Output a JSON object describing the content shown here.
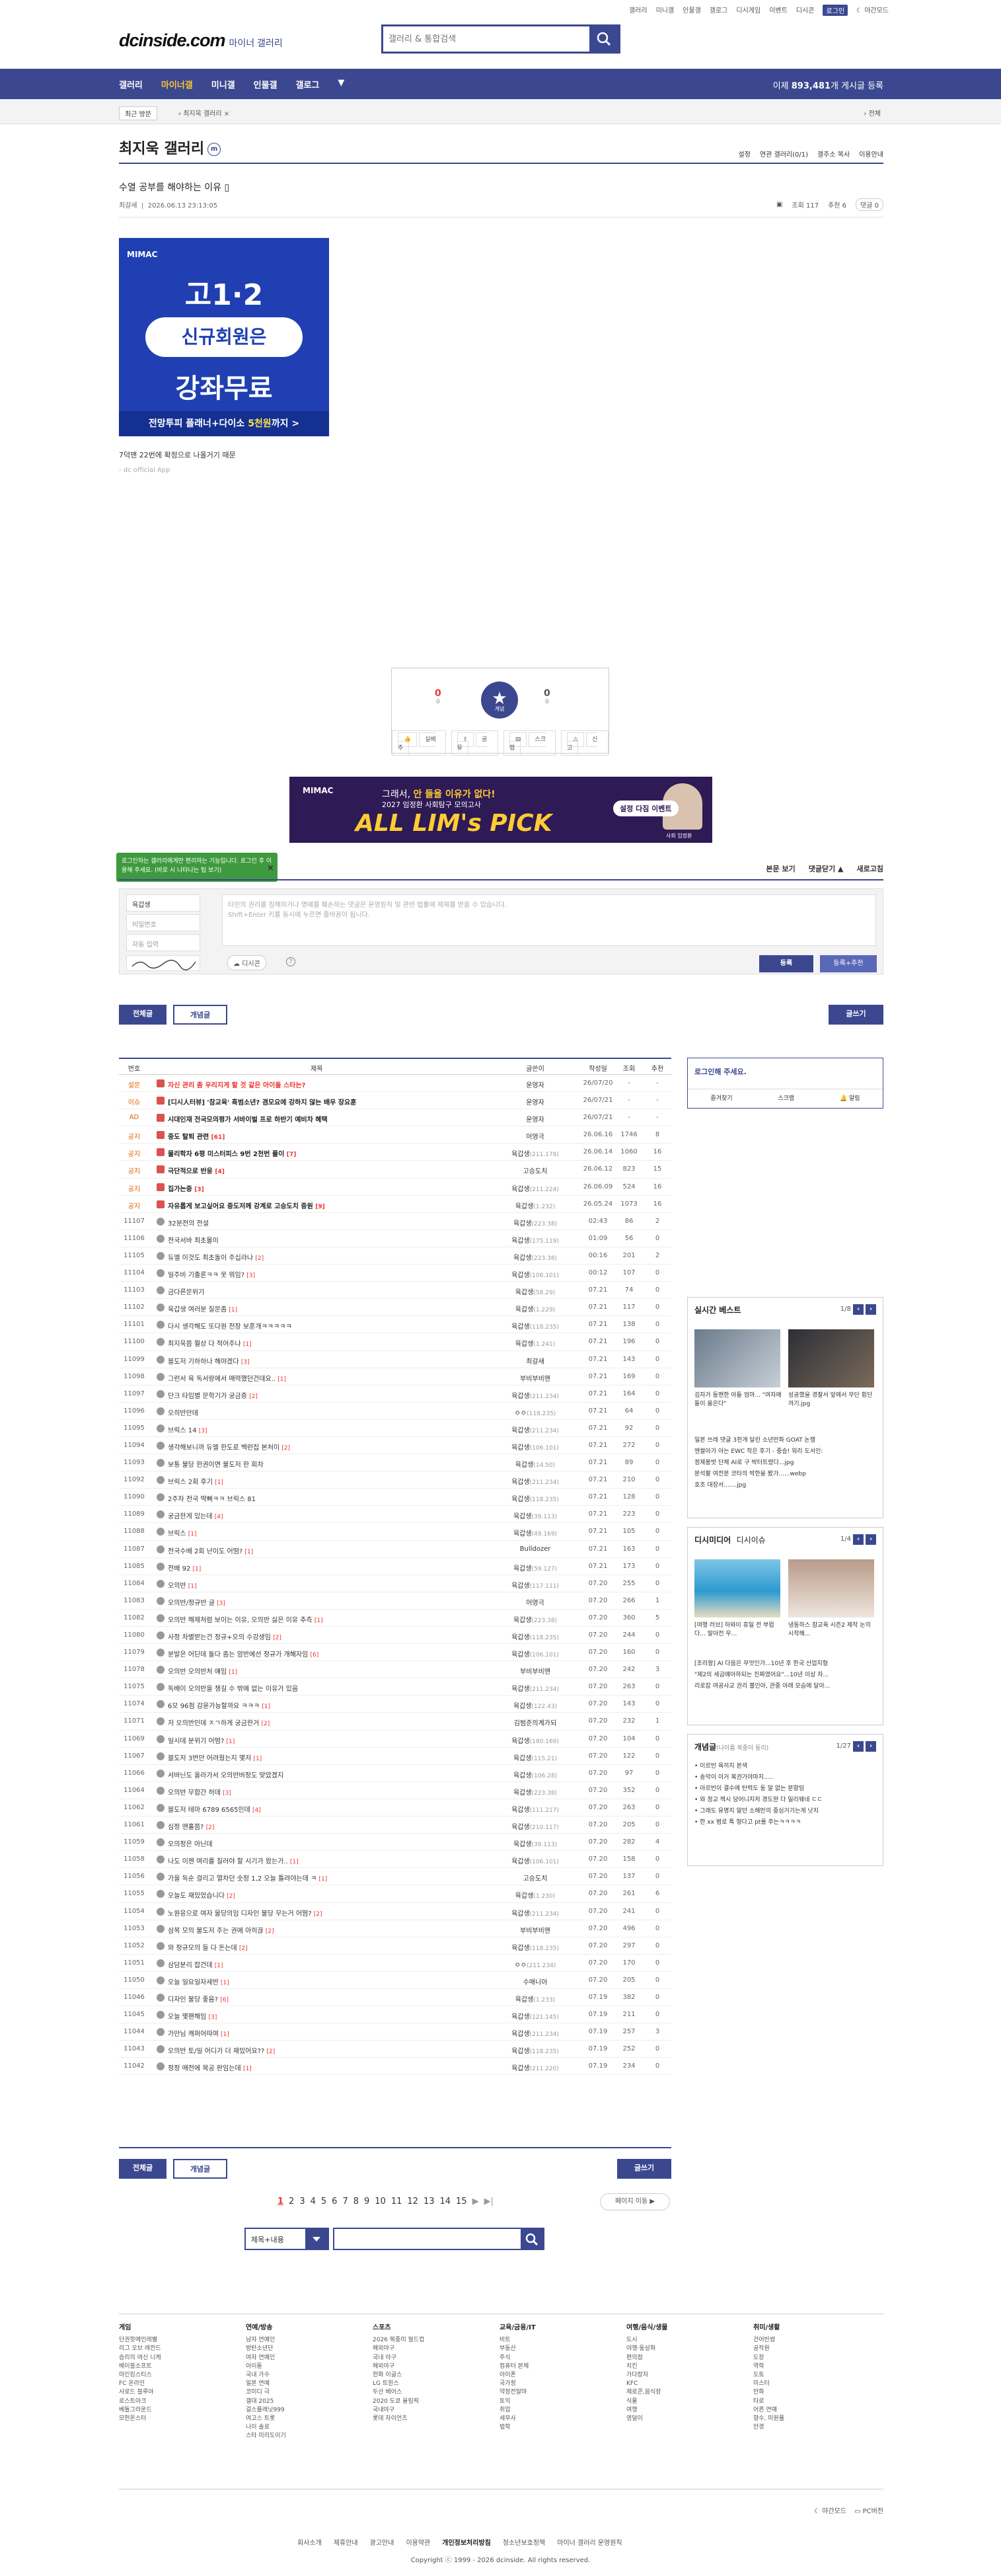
{
  "top": {
    "links": [
      "갤러리",
      "미니갤",
      "인물갤",
      "갤로그",
      "디시게임",
      "이벤트",
      "디시콘",
      "로그인"
    ],
    "dark": "야간모드"
  },
  "logo": {
    "main": "dcinside.com",
    "sub": "마이너 갤러리"
  },
  "search": {
    "placeholder": "갤러리 & 통합검색"
  },
  "gnb": {
    "items": [
      "갤러리",
      "마이너갤",
      "미니갤",
      "인물갤",
      "갤로그"
    ],
    "count_prefix": "이제 ",
    "count": "893,481",
    "count_suffix": "개 게시글 등록"
  },
  "subnav": {
    "recent": "최근 방문",
    "visited": "최지욱 갤러리",
    "all": "전체"
  },
  "gallery": {
    "title": "최지욱 갤러리",
    "badge": "m",
    "menu": [
      "설정",
      "연관 갤러리(0/1)",
      "갤주소 복사",
      "이용안내"
    ]
  },
  "post": {
    "title": "수열 공부를 해야하는 이유",
    "author": "최갈새",
    "date": "2026.06.13 23:13:05",
    "views": "조회 117",
    "recs": "추천 6",
    "comments": "댓글 0",
    "body": "7덕맨 22번에 확정으로 나올거기 때문",
    "app": "- dc official App"
  },
  "ad1": {
    "brand": "MIMAC",
    "line1": "고1·2",
    "line2": "신규회원은",
    "line3": "강좌무료",
    "line4a": "전망투피 플래너+다이소 ",
    "line4b": "5천원",
    "line4c": "까지 >"
  },
  "recommend": {
    "up": "0",
    "up_sub": "0",
    "star": "★",
    "star_sub": "개념",
    "down": "0",
    "down_sub": "0",
    "actions": [
      "실베추",
      "공유",
      "스크랩",
      "신고"
    ]
  },
  "ad2": {
    "brand": "MIMAC",
    "head_a": "그래서, ",
    "head_b": "안 들을 이유가 없다!",
    "sub": "2027 임정환 사회탐구 모의고사",
    "big": "ALL LIM's PICK",
    "btn": "설정 다짐 이벤트",
    "name": "사회 임정환"
  },
  "tip": {
    "text": "로그인하는 갤러리에게만 편리하는 기능입니다. 로그인 후 이용해 주세요. (바로 시 나타나는 팁 보기)"
  },
  "comment": {
    "opts": [
      "본문 보기",
      "댓글닫기 ▲",
      "새로고침"
    ],
    "nick": "육갑생",
    "pw": "비밀번호",
    "cap": "자동 입력",
    "text1": "타인의 권리를 침해하거나 명예를 훼손하는 댓글은 운영원칙 및 관련 법률에 제재를 받을 수 있습니다.",
    "text2": "Shift+Enter 키를 동시에 누르면 줄바꿈이 됩니다.",
    "dccon": "디시콘",
    "q": "?",
    "submit": "등록",
    "submit2": "등록+추천"
  },
  "tabs": {
    "all": "전체글",
    "best": "개념글",
    "write": "글쓰기"
  },
  "list": {
    "headers": [
      "번호",
      "제목",
      "글쓴이",
      "작성일",
      "조회",
      "추천"
    ],
    "rows": [
      {
        "no": "설문",
        "sub": "자신 관리 좀 우리지게 할 것 같은 아이돌 스타는?",
        "cnt": "",
        "w": "운영자",
        "ip": "",
        "d": "26/07/20",
        "v": "-",
        "r": "-",
        "t": "n",
        "red": true
      },
      {
        "no": "이슈",
        "sub": "[디시人터뷰] '참교육' 흑범소년? 겸모요에 강하지 않는 배우 장요훈",
        "cnt": "",
        "w": "운영자",
        "ip": "",
        "d": "26/07/21",
        "v": "-",
        "r": "-",
        "t": "n"
      },
      {
        "no": "AD",
        "sub": "시대인재 전국모의평가 서바이벌 프로 하반기 예비차 혜택",
        "cnt": "",
        "w": "운영자",
        "ip": "",
        "d": "26/07/21",
        "v": "-",
        "r": "-",
        "t": "n"
      },
      {
        "no": "공지",
        "sub": "중도 탈퇴 관련",
        "cnt": "[61]",
        "w": "어영극",
        "ip": "",
        "d": "26.06.16",
        "v": "1746",
        "r": "8",
        "t": "n"
      },
      {
        "no": "공지",
        "sub": "물리학자 6평 미스터피스 9번 2천번 풀이",
        "cnt": "[7]",
        "w": "육갑생",
        "ip": "(211.178)",
        "d": "26.06.14",
        "v": "1060",
        "r": "16",
        "t": "n"
      },
      {
        "no": "공지",
        "sub": "극단적으로 반응",
        "cnt": "[4]",
        "w": "고승도치",
        "ip": "",
        "d": "26.06.12",
        "v": "823",
        "r": "15",
        "t": "n"
      },
      {
        "no": "공지",
        "sub": "집가는중",
        "cnt": "[3]",
        "w": "육갑생",
        "ip": "(211.224)",
        "d": "26.06.09",
        "v": "524",
        "r": "16",
        "t": "n"
      },
      {
        "no": "공지",
        "sub": "자유롭게 보고싶어요 중도저께 강계로 고승도치 중원",
        "cnt": "[9]",
        "w": "육갑생",
        "ip": "(1.232)",
        "d": "26.05.24",
        "v": "1073",
        "r": "16",
        "t": "n"
      },
      {
        "no": "11107",
        "sub": "32분전의 전설",
        "cnt": "",
        "w": "육갑생",
        "ip": "(223.38)",
        "d": "02:43",
        "v": "86",
        "r": "2",
        "t": "g"
      },
      {
        "no": "11106",
        "sub": "전국서바 최초몰이",
        "cnt": "",
        "w": "육갑생",
        "ip": "(175.119)",
        "d": "01:09",
        "v": "56",
        "r": "0",
        "t": "g"
      },
      {
        "no": "11105",
        "sub": "듀엘 이것도 최초돌이 주십라나",
        "cnt": "[2]",
        "w": "육갑생",
        "ip": "(223.38)",
        "d": "00:16",
        "v": "201",
        "r": "2",
        "t": "g"
      },
      {
        "no": "11104",
        "sub": "일주비 기출론ㅋㅋ 못 뭐임?",
        "cnt": "[3]",
        "w": "육갑생",
        "ip": "(106.101)",
        "d": "00:12",
        "v": "107",
        "r": "0",
        "t": "g"
      },
      {
        "no": "11103",
        "sub": "금다른문위기",
        "cnt": "",
        "w": "육갑생",
        "ip": "(58.29)",
        "d": "07.21",
        "v": "74",
        "r": "0",
        "t": "g"
      },
      {
        "no": "11102",
        "sub": "육갑생 여러분 질문좀",
        "cnt": "[1]",
        "w": "육갑생",
        "ip": "(1.229)",
        "d": "07.21",
        "v": "117",
        "r": "0",
        "t": "g"
      },
      {
        "no": "11101",
        "sub": "다시 생각해도 또다원 전장 보훈개ㅋㅋㅋㅋㅋ",
        "cnt": "",
        "w": "육갑생",
        "ip": "(118.235)",
        "d": "07.21",
        "v": "138",
        "r": "0",
        "t": "g"
      },
      {
        "no": "11100",
        "sub": "최지욱쯤 뭘상 다 적어주나",
        "cnt": "[1]",
        "w": "육갑생",
        "ip": "(1.241)",
        "d": "07.21",
        "v": "196",
        "r": "0",
        "t": "g"
      },
      {
        "no": "11099",
        "sub": "블도저 기하하나 해야겠다",
        "cnt": "[3]",
        "w": "최갈새",
        "ip": "",
        "d": "07.21",
        "v": "143",
        "r": "0",
        "t": "g"
      },
      {
        "no": "11098",
        "sub": "그런서 육 독서랑에서 매력했던건데요..",
        "cnt": "[1]",
        "w": "부비부비맨",
        "ip": "",
        "d": "07.21",
        "v": "169",
        "r": "0",
        "t": "g"
      },
      {
        "no": "11097",
        "sub": "단크 타임별 문학기가 궁금증",
        "cnt": "[2]",
        "w": "육갑생",
        "ip": "(211.234)",
        "d": "07.21",
        "v": "164",
        "r": "0",
        "t": "g"
      },
      {
        "no": "11096",
        "sub": "오히반만데",
        "cnt": "",
        "w": "ㅇㅇ",
        "ip": "(118.235)",
        "d": "07.21",
        "v": "64",
        "r": "0",
        "t": "g"
      },
      {
        "no": "11095",
        "sub": "브릭스 14",
        "cnt": "[3]",
        "w": "육갑생",
        "ip": "(211.234)",
        "d": "07.21",
        "v": "92",
        "r": "0",
        "t": "g"
      },
      {
        "no": "11094",
        "sub": "생각해보니까 듀엘 한도로 백런집 본처이",
        "cnt": "[2]",
        "w": "육갑생",
        "ip": "(106.101)",
        "d": "07.21",
        "v": "272",
        "r": "0",
        "t": "g"
      },
      {
        "no": "11093",
        "sub": "보통 불당 한권이면 불도저 한 회차",
        "cnt": "",
        "w": "육갑생",
        "ip": "(14.50)",
        "d": "07.21",
        "v": "89",
        "r": "0",
        "t": "g"
      },
      {
        "no": "11092",
        "sub": "브릭스 2회 후기",
        "cnt": "[1]",
        "w": "육갑생",
        "ip": "(211.234)",
        "d": "07.21",
        "v": "210",
        "r": "0",
        "t": "g"
      },
      {
        "no": "11090",
        "sub": "2주차 전국 딱뻐ㅋㅋ 브릭스 81",
        "cnt": "",
        "w": "육갑생",
        "ip": "(118.235)",
        "d": "07.21",
        "v": "128",
        "r": "0",
        "t": "g"
      },
      {
        "no": "11089",
        "sub": "궁금한게 있는데",
        "cnt": "[4]",
        "w": "육갑생",
        "ip": "(39.113)",
        "d": "07.21",
        "v": "223",
        "r": "0",
        "t": "g"
      },
      {
        "no": "11088",
        "sub": "브릭스",
        "cnt": "[1]",
        "w": "육갑생",
        "ip": "(49.169)",
        "d": "07.21",
        "v": "105",
        "r": "0",
        "t": "g"
      },
      {
        "no": "11087",
        "sub": "전국수배 2회 난이도 어떰?",
        "cnt": "[1]",
        "w": "Bulldozer",
        "ip": "",
        "d": "07.21",
        "v": "163",
        "r": "0",
        "t": "g"
      },
      {
        "no": "11085",
        "sub": "전배 92",
        "cnt": "[1]",
        "w": "육갑생",
        "ip": "(59.127)",
        "d": "07.21",
        "v": "173",
        "r": "0",
        "t": "g"
      },
      {
        "no": "11084",
        "sub": "오의반",
        "cnt": "[1]",
        "w": "육갑생",
        "ip": "(117.111)",
        "d": "07.20",
        "v": "255",
        "r": "0",
        "t": "g"
      },
      {
        "no": "11083",
        "sub": "오의반/정규반 글",
        "cnt": "[3]",
        "w": "어영극",
        "ip": "",
        "d": "07.20",
        "v": "266",
        "r": "1",
        "t": "g"
      },
      {
        "no": "11082",
        "sub": "오의반 해제처럼 보이는 이유, 오의반 싫은 이유 추측",
        "cnt": "[1]",
        "w": "육갑생",
        "ip": "(223.38)",
        "d": "07.20",
        "v": "360",
        "r": "5",
        "t": "g"
      },
      {
        "no": "11080",
        "sub": "사정 차별받는건 정규+오의 수강생임",
        "cnt": "[2]",
        "w": "육갑생",
        "ip": "(118.235)",
        "d": "07.20",
        "v": "244",
        "r": "0",
        "t": "g"
      },
      {
        "no": "11079",
        "sub": "분발은 어딘데 돌다 좀는 암반에선 정규가 개혜자임",
        "cnt": "[6]",
        "w": "육갑생",
        "ip": "(106.101)",
        "d": "07.20",
        "v": "160",
        "r": "0",
        "t": "g"
      },
      {
        "no": "11078",
        "sub": "오의반 오의반처 얘임",
        "cnt": "[1]",
        "w": "부비부비맨",
        "ip": "",
        "d": "07.20",
        "v": "242",
        "r": "3",
        "t": "g"
      },
      {
        "no": "11075",
        "sub": "독배이 오의반을 챙길 수 밖에 없는 이유가 있음",
        "cnt": "",
        "w": "육갑생",
        "ip": "(211.234)",
        "d": "07.20",
        "v": "263",
        "r": "0",
        "t": "g"
      },
      {
        "no": "11074",
        "sub": "6모 96점 감윤가능할까요 ㅋㅋㅋ",
        "cnt": "[1]",
        "w": "육갑생",
        "ip": "(122.43)",
        "d": "07.20",
        "v": "143",
        "r": "0",
        "t": "g"
      },
      {
        "no": "11071",
        "sub": "저 오의반인데 ㅈㄱ하게 궁금한거",
        "cnt": "[2]",
        "w": "김범준의계가되",
        "ip": "",
        "d": "07.20",
        "v": "232",
        "r": "1",
        "t": "g"
      },
      {
        "no": "11069",
        "sub": "일시데 분위기 어떰?",
        "cnt": "[1]",
        "w": "육갑생",
        "ip": "(180.169)",
        "d": "07.20",
        "v": "104",
        "r": "0",
        "t": "g"
      },
      {
        "no": "11067",
        "sub": "블도저 3번만 어려웠는지 몇저",
        "cnt": "[1]",
        "w": "육갑생",
        "ip": "(115.21)",
        "d": "07.20",
        "v": "122",
        "r": "0",
        "t": "g"
      },
      {
        "no": "11066",
        "sub": "서바닌도 올라가서 오의반버정도 맞았겠지",
        "cnt": "",
        "w": "육갑생",
        "ip": "(106.28)",
        "d": "07.20",
        "v": "97",
        "r": "0",
        "t": "g"
      },
      {
        "no": "11064",
        "sub": "오의반 무합간 허데",
        "cnt": "[3]",
        "w": "육갑생",
        "ip": "(223.38)",
        "d": "07.20",
        "v": "352",
        "r": "0",
        "t": "g"
      },
      {
        "no": "11062",
        "sub": "블도저 테마 6789 6565인데",
        "cnt": "[4]",
        "w": "육갑생",
        "ip": "(111.217)",
        "d": "07.20",
        "v": "263",
        "r": "0",
        "t": "g"
      },
      {
        "no": "11061",
        "sub": "심정 맨홀쯤?",
        "cnt": "[2]",
        "w": "육갑생",
        "ip": "(210.117)",
        "d": "07.20",
        "v": "205",
        "r": "0",
        "t": "g"
      },
      {
        "no": "11059",
        "sub": "오의정은 아닌데",
        "cnt": "",
        "w": "육갑생",
        "ip": "(39.113)",
        "d": "07.20",
        "v": "282",
        "r": "4",
        "t": "g"
      },
      {
        "no": "11058",
        "sub": "나도 이젠 여리를 질러야 할 시기가 왔는가..",
        "cnt": "[1]",
        "w": "육갑생",
        "ip": "(106.101)",
        "d": "07.20",
        "v": "158",
        "r": "0",
        "t": "g"
      },
      {
        "no": "11056",
        "sub": "가을 독순 걸리고 열차던 숫정 1,2 오늘 틀려야는데 ㅋ",
        "cnt": "[1]",
        "w": "고승도치",
        "ip": "",
        "d": "07.20",
        "v": "137",
        "r": "0",
        "t": "g"
      },
      {
        "no": "11055",
        "sub": "오늘도 재밌었습니다",
        "cnt": "[2]",
        "w": "육갑생",
        "ip": "(1.230)",
        "d": "07.20",
        "v": "261",
        "r": "6",
        "t": "g"
      },
      {
        "no": "11054",
        "sub": "노원응으로 여자 물당의임 디자인 불당 무는거 어떰?",
        "cnt": "[2]",
        "w": "육갑생",
        "ip": "(211.234)",
        "d": "07.20",
        "v": "241",
        "r": "0",
        "t": "g"
      },
      {
        "no": "11053",
        "sub": "삼복 모의 불도저 주는 권에 아히끊",
        "cnt": "[2]",
        "w": "부비부비맨",
        "ip": "",
        "d": "07.20",
        "v": "496",
        "r": "0",
        "t": "g"
      },
      {
        "no": "11052",
        "sub": "와 정규모의 들 다 돈는데",
        "cnt": "[2]",
        "w": "육갑생",
        "ip": "(118.235)",
        "d": "07.20",
        "v": "297",
        "r": "0",
        "t": "g"
      },
      {
        "no": "11051",
        "sub": "삼담분리 잡건데",
        "cnt": "[1]",
        "w": "ㅇㅇ",
        "ip": "(211.234)",
        "d": "07.20",
        "v": "170",
        "r": "0",
        "t": "g"
      },
      {
        "no": "11050",
        "sub": "오늘 일요일자세반",
        "cnt": "[1]",
        "w": "수매니아",
        "ip": "",
        "d": "07.20",
        "v": "205",
        "r": "0",
        "t": "g"
      },
      {
        "no": "11046",
        "sub": "디자인 불당 좋음?",
        "cnt": "[6]",
        "w": "육갑생",
        "ip": "(1.233)",
        "d": "07.19",
        "v": "382",
        "r": "0",
        "t": "g"
      },
      {
        "no": "11045",
        "sub": "오늘 몇팬해임",
        "cnt": "[3]",
        "w": "육갑생",
        "ip": "(121.145)",
        "d": "07.19",
        "v": "211",
        "r": "0",
        "t": "g"
      },
      {
        "no": "11044",
        "sub": "가만님 캐퍼어따여",
        "cnt": "[1]",
        "w": "육갑생",
        "ip": "(211.234)",
        "d": "07.19",
        "v": "257",
        "r": "3",
        "t": "g"
      },
      {
        "no": "11043",
        "sub": "오의반 토/일 어디가 더 재밌어요??",
        "cnt": "[2]",
        "w": "육갑생",
        "ip": "(118.235)",
        "d": "07.19",
        "v": "252",
        "r": "0",
        "t": "g"
      },
      {
        "no": "11042",
        "sub": "정정 매전에 목공 판임는데",
        "cnt": "[1]",
        "w": "육갑생",
        "ip": "(211.220)",
        "d": "07.19",
        "v": "234",
        "r": "0",
        "t": "g"
      }
    ]
  },
  "side": {
    "login": "로그인해 주세요.",
    "links": [
      "즐겨찾기",
      "스크랩",
      "알림"
    ],
    "realtime": {
      "title": "실시간 베스트",
      "page": "1/8",
      "cap1": "김자가 동맨한 아들 엄마... \"여자애들이 옮은다\"",
      "cap2": "성공했을 경찰서 앞에서 무단 횡단까기.jpg",
      "items": [
        "일본 쓰레 댓글 3천개 달린 소년만화 GOAT 논쟁",
        "엔쌀아가 아는 EWC 착은 후기 - 중승! 워리 도서인:",
        "정제봉밧 단체 AI로 구 박터트렸다...jpg",
        "분석팔 여전분 코타의 박한을 봤가......webp",
        "호조 대장서.......jpg"
      ]
    },
    "dcmedia": {
      "title": "디시미디어",
      "title2": "디시이슈",
      "page": "1/4",
      "cap1": "[여행 러브] 하와이 휴일 전 부럽다... 말아전 우...",
      "cap2": "냉동하스 참교육 시즌2 제작 논의 시작해..."
    },
    "notice_lines": [
      "[조리왕] AI 다음은 무엇인가...10년 후 한국 산업지형",
      "\"제2의 세금얘아하되는 진짜였어요\"...10년 이상 자...",
      "리로잡 여공사교 권리 불인아, 관중 아래 모습에 달아..."
    ],
    "minor": {
      "title": "개념글",
      "title_sub": "(나이름 북중이 둥리)",
      "page": "1/27",
      "items": [
        "이르빈 육끼지 본색",
        "송악이 이거 복권가야마지..... ",
        "아르빈이 결수에 탄력도 동 말 없는 분향임",
        "와 정교 잭시 당어니지저 경도완 다 일리웨네 ㄷㄷ",
        "그래도 유명지 알던 소해만의 중심거기는게 낫치",
        "한 xx 범로 특 형다고 pt를 주는ㅋㅋㅋㅋ"
      ]
    }
  },
  "paging": {
    "pages": [
      "1",
      "2",
      "3",
      "4",
      "5",
      "6",
      "7",
      "8",
      "9",
      "10",
      "11",
      "12",
      "13",
      "14",
      "15"
    ],
    "next": "▶",
    "last": "▶|",
    "move": "페이지 이동 ▶"
  },
  "bottom_search": {
    "select": "제목+내용"
  },
  "footer": {
    "cols": [
      {
        "h": "게임",
        "items": [
          "단권핫메인레벨",
          "리그 오브 레전드",
          "승리의 여신 니케",
          "배이블소프트",
          "마인킹스티스",
          "FC 온라인",
          "사로드 블루아",
          "로스트아크",
          "베틀그라운드",
          "모헌몬스터"
        ]
      },
      {
        "h": "연예/방송",
        "items": [
          "남자 연예인",
          "방탄소년단",
          "여자 연예인",
          "아이돌 ",
          "국내 가수",
          "일본 연예",
          "코미디 극",
          "갤대 2025",
          "걸스플래닛999",
          "여고스 트롯",
          "나이 솔로",
          "스타 미리도이기"
        ]
      },
      {
        "h": "스포츠",
        "items": [
          "2026 북중미 월드컵",
          "해외야구",
          "국내 야구",
          "해외야구",
          "한화 이글스",
          "LG 트윈스",
          "두산 베어스",
          "2020 도쿄 올림픽",
          "국내야구",
          "롯데 자이언츠"
        ]
      },
      {
        "h": "교육/금융/IT",
        "items": [
          "비트",
          "부동산",
          "주식",
          "컴퓨터 본체",
          "아이폰",
          "국가정",
          "약정전말마",
          "토익",
          "취업",
          "세무사",
          "법학"
        ]
      },
      {
        "h": "여행/음식/생물",
        "items": [
          "도시",
          "야행·동상화",
          "편의점",
          "치킨",
          "가다랑자",
          "KFC",
          "제로콘,음식장",
          "식물",
          "여행",
          "영덜이"
        ]
      },
      {
        "h": "취미/생활",
        "items": [
          "건어빈쌈",
          "공작원",
          "도장",
          "역학",
          "도토",
          "미스터",
          "만화",
          "타로",
          "어른 연예",
          "향수, 미원풀",
          "안경"
        ]
      }
    ],
    "dark": "야간모드",
    "pc": "PC버전",
    "mobile": "모바일",
    "links": [
      "회사소개",
      "제휴안내",
      "광고안내",
      "이용약관",
      "개인정보처리방침",
      "청소년보호정책",
      "마이너 갤러리 운영원칙"
    ],
    "copy": "Copyright ⓒ 1999 - 2026 dcinside. All rights reserved."
  }
}
